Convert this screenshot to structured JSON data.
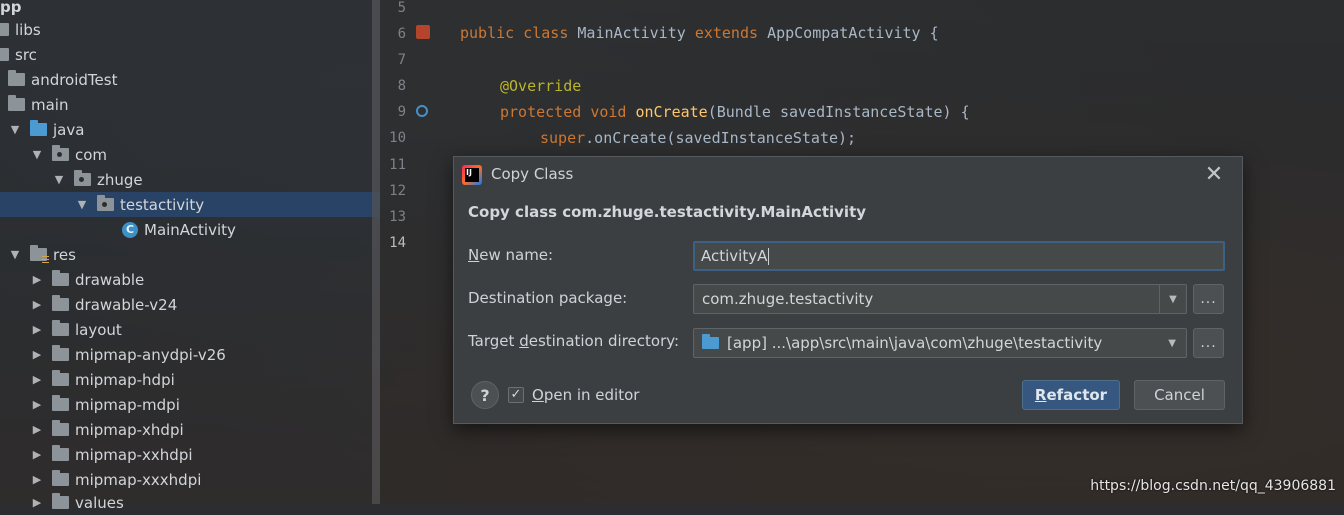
{
  "project_tree": {
    "items": [
      {
        "label": "pp"
      },
      {
        "label": "libs"
      },
      {
        "label": "src"
      },
      {
        "label": "androidTest"
      },
      {
        "label": "main"
      },
      {
        "label": "java"
      },
      {
        "label": "com"
      },
      {
        "label": "zhuge"
      },
      {
        "label": "testactivity"
      },
      {
        "label": "MainActivity",
        "icon_letter": "C"
      },
      {
        "label": "res"
      },
      {
        "label": "drawable"
      },
      {
        "label": "drawable-v24"
      },
      {
        "label": "layout"
      },
      {
        "label": "mipmap-anydpi-v26"
      },
      {
        "label": "mipmap-hdpi"
      },
      {
        "label": "mipmap-mdpi"
      },
      {
        "label": "mipmap-xhdpi"
      },
      {
        "label": "mipmap-xxhdpi"
      },
      {
        "label": "mipmap-xxxhdpi"
      },
      {
        "label": "values"
      }
    ]
  },
  "editor": {
    "line_numbers": [
      "5",
      "6",
      "7",
      "8",
      "9",
      "10",
      "11",
      "12",
      "13",
      "14"
    ],
    "code": {
      "l6_public": "public",
      "l6_class": "class",
      "l6_name": "MainActivity",
      "l6_extends": "extends",
      "l6_parent": "AppCompatActivity {",
      "l8_annotation": "@Override",
      "l9_protected": "protected",
      "l9_void": "void",
      "l9_method": "onCreate",
      "l9_params": "(Bundle savedInstanceState) {",
      "l10_super": "super",
      "l10_call": ".onCreate(savedInstanceState);"
    }
  },
  "dialog": {
    "title": "Copy Class",
    "app_icon_text": "IJ",
    "close_glyph": "✕",
    "heading": "Copy class com.zhuge.testactivity.MainActivity",
    "new_name": {
      "label_prefix": "",
      "label_mnemonic": "N",
      "label_rest": "ew name:",
      "value": "ActivityA"
    },
    "destination_package": {
      "label": "Destination package:",
      "value": "com.zhuge.testactivity",
      "browse": "..."
    },
    "target_directory": {
      "label_prefix": "Target ",
      "label_mnemonic": "d",
      "label_rest": "estination directory:",
      "value": "[app] ...\\app\\src\\main\\java\\com\\zhuge\\testactivity",
      "browse": "..."
    },
    "help_glyph": "?",
    "open_in_editor": {
      "checked_glyph": "✓",
      "label_mnemonic": "O",
      "label_rest": "pen in editor"
    },
    "refactor_button": {
      "mnemonic": "R",
      "rest": "efactor"
    },
    "cancel_button": "Cancel"
  },
  "watermark": "https://blog.csdn.net/qq_43906881",
  "colors": {
    "keyword": "#cc7832",
    "annotation": "#bbb529",
    "method": "#ffc66d",
    "selection": "#284670",
    "primary_button": "#365880"
  }
}
